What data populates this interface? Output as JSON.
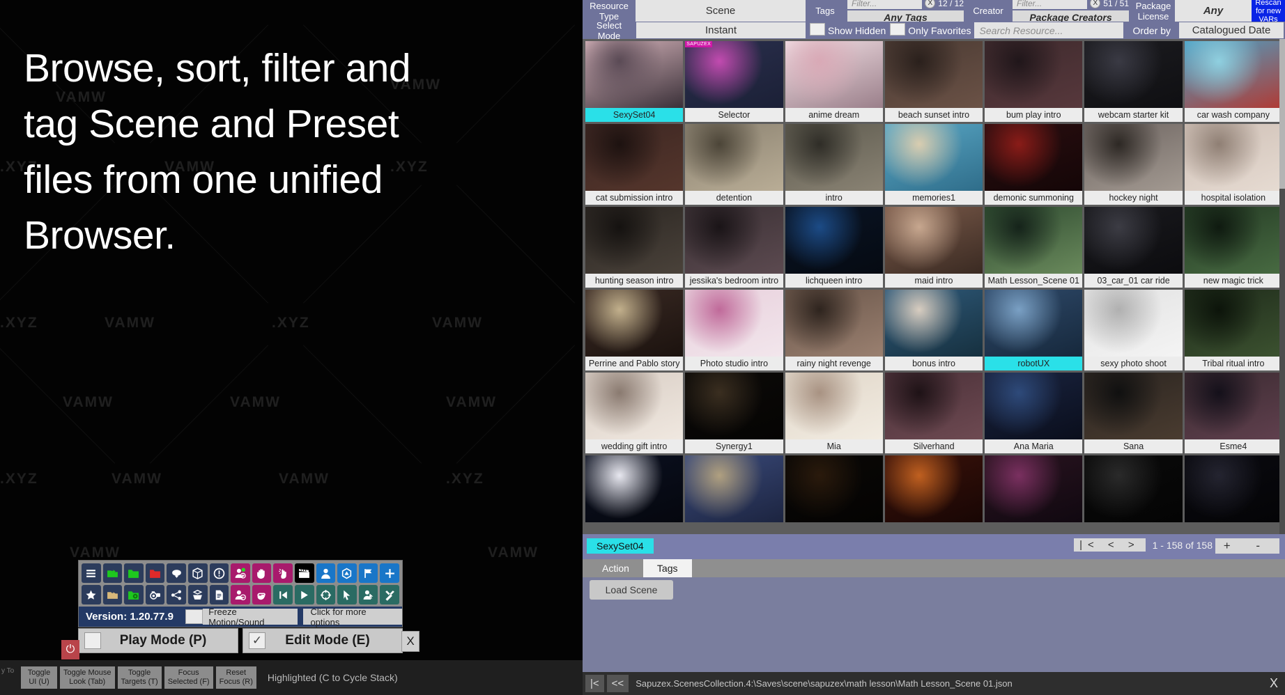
{
  "promo": {
    "text": "Browse, sort, filter and tag Scene and Preset files from one unified Browser."
  },
  "watermarks": {
    "brand": "VAMW.XYZ",
    "short": ".XYZ",
    "logo": "VAMW"
  },
  "browser": {
    "filters": {
      "resource_type_label": "Resource\nType",
      "resource_type_value": "Scene",
      "select_mode_label": "Select Mode",
      "select_mode_value": "Instant",
      "tags_label": "Tags",
      "tags_filter_placeholder": "Filter...",
      "tags_clear": "X",
      "tags_count": "12 / 12",
      "tags_value": "Any Tags",
      "creator_label": "Creator",
      "creator_filter_placeholder": "Filter...",
      "creator_clear": "X",
      "creator_count": "51 / 51",
      "creator_value": "Package Creators",
      "package_license_label": "Package\nLicense",
      "package_license_value": "Any",
      "rescan_label": "Rescan for new VARs",
      "show_hidden": "Show Hidden",
      "only_favorites": "Only Favorites",
      "search_placeholder": "Search Resource...",
      "order_by_label": "Order by",
      "order_by_value": "Catalogued Date"
    },
    "grid": {
      "rows": [
        [
          {
            "name": "SexySet04",
            "selected": true,
            "badge": "",
            "c1": "#d8b6bd",
            "c2": "#5a4a55",
            "c3": "#3a3038"
          },
          {
            "name": "Selector",
            "selected": false,
            "badge": "SAPUZEX",
            "c1": "#2a2f4d",
            "c2": "#c24bb0",
            "c3": "#1b2036"
          },
          {
            "name": "anime dream",
            "selected": false,
            "badge": "",
            "c1": "#f2dfe4",
            "c2": "#d9a9b6",
            "c3": "#9a7f8a"
          },
          {
            "name": "beach sunset intro",
            "selected": false,
            "badge": "",
            "c1": "#4a3a33",
            "c2": "#2a201c",
            "c3": "#6b5246"
          },
          {
            "name": "bum play intro",
            "selected": false,
            "badge": "",
            "c1": "#3e2a2d",
            "c2": "#20161a",
            "c3": "#57383c"
          },
          {
            "name": "webcam starter kit",
            "selected": false,
            "badge": "",
            "c1": "#1c1c20",
            "c2": "#3a3a44",
            "c3": "#0f0f12"
          },
          {
            "name": "car wash company",
            "selected": false,
            "badge": "",
            "c1": "#4aa3c8",
            "c2": "#8fd0e0",
            "c3": "#b03a34"
          }
        ],
        [
          {
            "name": "cat submission intro",
            "selected": false,
            "badge": "",
            "c1": "#3c2622",
            "c2": "#1d1210",
            "c3": "#55362c"
          },
          {
            "name": "detention",
            "selected": false,
            "badge": "",
            "c1": "#8a8170",
            "c2": "#4c4538",
            "c3": "#b9ad96"
          },
          {
            "name": "intro",
            "selected": false,
            "badge": "",
            "c1": "#5d5a4e",
            "c2": "#2f2d27",
            "c3": "#8a8374"
          },
          {
            "name": "memories1",
            "selected": false,
            "badge": "",
            "c1": "#5aa8c6",
            "c2": "#d9cdb0",
            "c3": "#2f6d8a"
          },
          {
            "name": "demonic summoning",
            "selected": false,
            "badge": "",
            "c1": "#2a0e10",
            "c2": "#8a1c18",
            "c3": "#140607"
          },
          {
            "name": "hockey night",
            "selected": false,
            "badge": "",
            "c1": "#6d6460",
            "c2": "#2d2824",
            "c3": "#a39a92"
          },
          {
            "name": "hospital isolation",
            "selected": false,
            "badge": "",
            "c1": "#cfc0b6",
            "c2": "#8f7f74",
            "c3": "#e6dbd2"
          }
        ],
        [
          {
            "name": "hunting season intro",
            "selected": false,
            "badge": "",
            "c1": "#2b2622",
            "c2": "#151210",
            "c3": "#4a423a"
          },
          {
            "name": "jessika's bedroom intro",
            "selected": false,
            "badge": "",
            "c1": "#3a3034",
            "c2": "#1a1417",
            "c3": "#5c4a50"
          },
          {
            "name": "lichqueen intro",
            "selected": false,
            "badge": "",
            "c1": "#0a1424",
            "c2": "#1c4b86",
            "c3": "#050a12"
          },
          {
            "name": "maid intro",
            "selected": false,
            "badge": "",
            "c1": "#7a5a4a",
            "c2": "#c7a78f",
            "c3": "#3a2a22"
          },
          {
            "name": "Math Lesson_Scene 01",
            "selected": false,
            "badge": "",
            "c1": "#2e4a30",
            "c2": "#15231a",
            "c3": "#6a8a5c"
          },
          {
            "name": "03_car_01 car ride",
            "selected": false,
            "badge": "",
            "c1": "#1a1a1e",
            "c2": "#3c3c44",
            "c3": "#0c0c0f"
          },
          {
            "name": "new magic trick",
            "selected": false,
            "badge": "",
            "c1": "#243a24",
            "c2": "#0f1a10",
            "c3": "#486b42"
          }
        ],
        [
          {
            "name": "Perrine and Pablo story",
            "selected": false,
            "badge": "",
            "c1": "#3a2a24",
            "c2": "#c2b08c",
            "c3": "#1b120e"
          },
          {
            "name": "Photo studio intro",
            "selected": false,
            "badge": "",
            "c1": "#e8d0dc",
            "c2": "#c06a9a",
            "c3": "#f2e6ec"
          },
          {
            "name": "rainy night revenge",
            "selected": false,
            "badge": "",
            "c1": "#6a564a",
            "c2": "#2e241e",
            "c3": "#9a8070"
          },
          {
            "name": "bonus intro",
            "selected": false,
            "badge": "",
            "c1": "#2f5a7a",
            "c2": "#d8cdc0",
            "c3": "#16303f"
          },
          {
            "name": "robotUX",
            "selected": true,
            "badge": "",
            "c1": "#2f4a6a",
            "c2": "#7aa0c4",
            "c3": "#16283c"
          },
          {
            "name": "sexy photo shoot",
            "selected": false,
            "badge": "",
            "c1": "#e2e2e2",
            "c2": "#b0b0b0",
            "c3": "#f4f4f4"
          },
          {
            "name": "Tribal ritual intro",
            "selected": false,
            "badge": "",
            "c1": "#1e2a1a",
            "c2": "#0c140a",
            "c3": "#3c5230"
          }
        ],
        [
          {
            "name": "wedding gift intro",
            "selected": false,
            "badge": "",
            "c1": "#d8cdc4",
            "c2": "#8a7a70",
            "c3": "#f0e8e0"
          },
          {
            "name": "Synergy1",
            "selected": false,
            "badge": "",
            "c1": "#0c0a08",
            "c2": "#3a2e20",
            "c3": "#050403"
          },
          {
            "name": "Mia",
            "selected": false,
            "badge": "",
            "c1": "#e0d6c8",
            "c2": "#a89282",
            "c3": "#f2ece2"
          },
          {
            "name": "Silverhand",
            "selected": false,
            "badge": "",
            "c1": "#4a3038",
            "c2": "#1e1216",
            "c3": "#6e4a52"
          },
          {
            "name": "Ana Maria",
            "selected": false,
            "badge": "",
            "c1": "#1a2440",
            "c2": "#2e4a7a",
            "c3": "#0a0e1c"
          },
          {
            "name": "Sana",
            "selected": false,
            "badge": "",
            "c1": "#2a2420",
            "c2": "#101010",
            "c3": "#4a3c30"
          },
          {
            "name": "Esme4",
            "selected": false,
            "badge": "",
            "c1": "#3a2a30",
            "c2": "#14101a",
            "c3": "#60404e"
          }
        ],
        [
          {
            "name": "",
            "selected": false,
            "badge": "",
            "c1": "#0b1020",
            "c2": "#e8e8f0",
            "c3": "#05070e"
          },
          {
            "name": "",
            "selected": false,
            "badge": "",
            "c1": "#3a4a7a",
            "c2": "#b0a080",
            "c3": "#1c2440"
          },
          {
            "name": "",
            "selected": false,
            "badge": "",
            "c1": "#0a0806",
            "c2": "#2a1a0c",
            "c3": "#040302"
          },
          {
            "name": "",
            "selected": false,
            "badge": "",
            "c1": "#3a120a",
            "c2": "#c06020",
            "c3": "#180604"
          },
          {
            "name": "",
            "selected": false,
            "badge": "",
            "c1": "#2a1420",
            "c2": "#7a3060",
            "c3": "#100810"
          },
          {
            "name": "",
            "selected": false,
            "badge": "",
            "c1": "#0a0a0a",
            "c2": "#2a2a2a",
            "c3": "#040404"
          },
          {
            "name": "",
            "selected": false,
            "badge": "",
            "c1": "#0a0a10",
            "c2": "#242430",
            "c3": "#040406"
          }
        ]
      ]
    },
    "selection": {
      "tag": "SexySet04",
      "pager_buttons": "|< < >",
      "pager_text": "1 - 158 of 158",
      "zoom_plus": "+",
      "zoom_minus": "-"
    },
    "tabs": [
      {
        "label": "Action",
        "active": false
      },
      {
        "label": "Tags",
        "active": true
      }
    ],
    "load_scene_label": "Load Scene",
    "path_bar": {
      "first_btn": "|<",
      "back_btn": "<<",
      "path": "Sapuzex.ScenesCollection.4:\\Saves\\scene\\sapuzex\\math lesson\\Math Lesson_Scene 01.json",
      "close": "X"
    }
  },
  "vam": {
    "toolbar_row1": [
      {
        "name": "menu-icon",
        "color": "navy",
        "glyph": "menu"
      },
      {
        "name": "load-scene-icon",
        "color": "navy",
        "glyph": "folder-open-green"
      },
      {
        "name": "open-folder-icon",
        "color": "navy",
        "glyph": "folder-green"
      },
      {
        "name": "save-scene-icon",
        "color": "navy",
        "glyph": "folder-red"
      },
      {
        "name": "cloud-download-icon",
        "color": "navy",
        "glyph": "cloud"
      },
      {
        "name": "package-icon",
        "color": "navy",
        "glyph": "box"
      },
      {
        "name": "warning-icon",
        "color": "navy",
        "glyph": "exclaim"
      },
      {
        "name": "add-person-icon",
        "color": "magenta",
        "glyph": "person-add"
      },
      {
        "name": "hand-icon",
        "color": "magenta",
        "glyph": "hand"
      },
      {
        "name": "pointer-hand-icon",
        "color": "magenta",
        "glyph": "pointer-hand"
      },
      {
        "name": "clapperboard-icon",
        "color": "black",
        "glyph": "clapper"
      },
      {
        "name": "person-icon",
        "color": "blue",
        "glyph": "person"
      },
      {
        "name": "unity-icon",
        "color": "blue",
        "glyph": "unity"
      },
      {
        "name": "flag-icon",
        "color": "blue",
        "glyph": "flag"
      },
      {
        "name": "add-atom-icon",
        "color": "blue",
        "glyph": "plus"
      }
    ],
    "toolbar_row2": [
      {
        "name": "favorite-star-icon",
        "color": "navy",
        "glyph": "star"
      },
      {
        "name": "merge-load-icon",
        "color": "navy",
        "glyph": "folder-tan"
      },
      {
        "name": "folder-settings-icon",
        "color": "navy",
        "glyph": "folder-gear"
      },
      {
        "name": "screenshot-icon",
        "color": "navy",
        "glyph": "camera"
      },
      {
        "name": "node-graph-icon",
        "color": "navy",
        "glyph": "nodes"
      },
      {
        "name": "open-package-icon",
        "color": "navy",
        "glyph": "open-box"
      },
      {
        "name": "file-icon",
        "color": "navy",
        "glyph": "file"
      },
      {
        "name": "remove-person-icon",
        "color": "magenta",
        "glyph": "person-remove"
      },
      {
        "name": "grab-hand-icon",
        "color": "magenta",
        "glyph": "grab"
      },
      {
        "name": "skip-back-icon",
        "color": "teal",
        "glyph": "skip-back"
      },
      {
        "name": "play-icon",
        "color": "teal",
        "glyph": "play"
      },
      {
        "name": "target-icon",
        "color": "teal",
        "glyph": "target"
      },
      {
        "name": "cursor-icon",
        "color": "teal",
        "glyph": "cursor"
      },
      {
        "name": "select-person-icon",
        "color": "teal",
        "glyph": "person-select"
      },
      {
        "name": "tools-icon",
        "color": "teal",
        "glyph": "tools"
      }
    ],
    "version_label": "Version: 1.20.77.9",
    "freeze_label": "Freeze Motion/Sound",
    "more_options_label": "Click for more options",
    "play_mode_label": "Play Mode (P)",
    "edit_mode_label": "Edit Mode (E)",
    "edit_mode_checked": "✓",
    "close_label": "X",
    "power_label": "⏻",
    "hint_buttons": [
      "Toggle\nUI (U)",
      "Toggle Mouse\nLook (Tab)",
      "Toggle\nTargets (T)",
      "Focus\nSelected (F)",
      "Reset\nFocus (R)"
    ],
    "hint_text": "Highlighted (C to Cycle Stack)",
    "toby_text": "y To"
  }
}
